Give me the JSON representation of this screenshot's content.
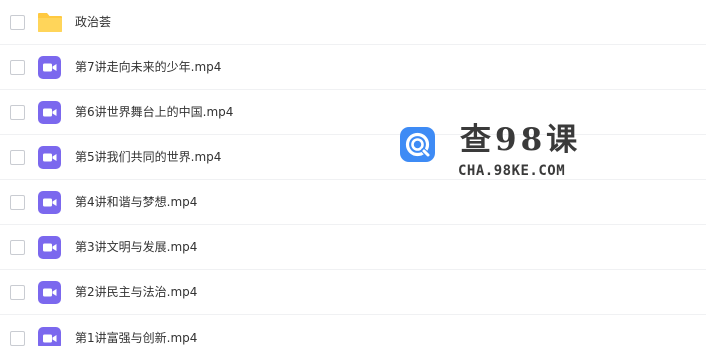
{
  "files": [
    {
      "name": "政治荟",
      "type": "folder"
    },
    {
      "name": "第7讲走向未来的少年.mp4",
      "type": "video"
    },
    {
      "name": "第6讲世界舞台上的中国.mp4",
      "type": "video"
    },
    {
      "name": "第5讲我们共同的世界.mp4",
      "type": "video"
    },
    {
      "name": "第4讲和谐与梦想.mp4",
      "type": "video"
    },
    {
      "name": "第3讲文明与发展.mp4",
      "type": "video"
    },
    {
      "name": "第2讲民主与法治.mp4",
      "type": "video"
    },
    {
      "name": "第1讲富强与创新.mp4",
      "type": "video"
    }
  ],
  "watermark": {
    "title": "查98课",
    "url": "CHA.98KE.COM"
  },
  "colors": {
    "folder": "#FFC940",
    "video": "#7B68EE",
    "watermark_logo": "#3E8BF5",
    "text": "#333333"
  },
  "icons": {
    "folder": "folder-icon",
    "video": "video-camera-icon",
    "logo": "search-logo-icon"
  }
}
